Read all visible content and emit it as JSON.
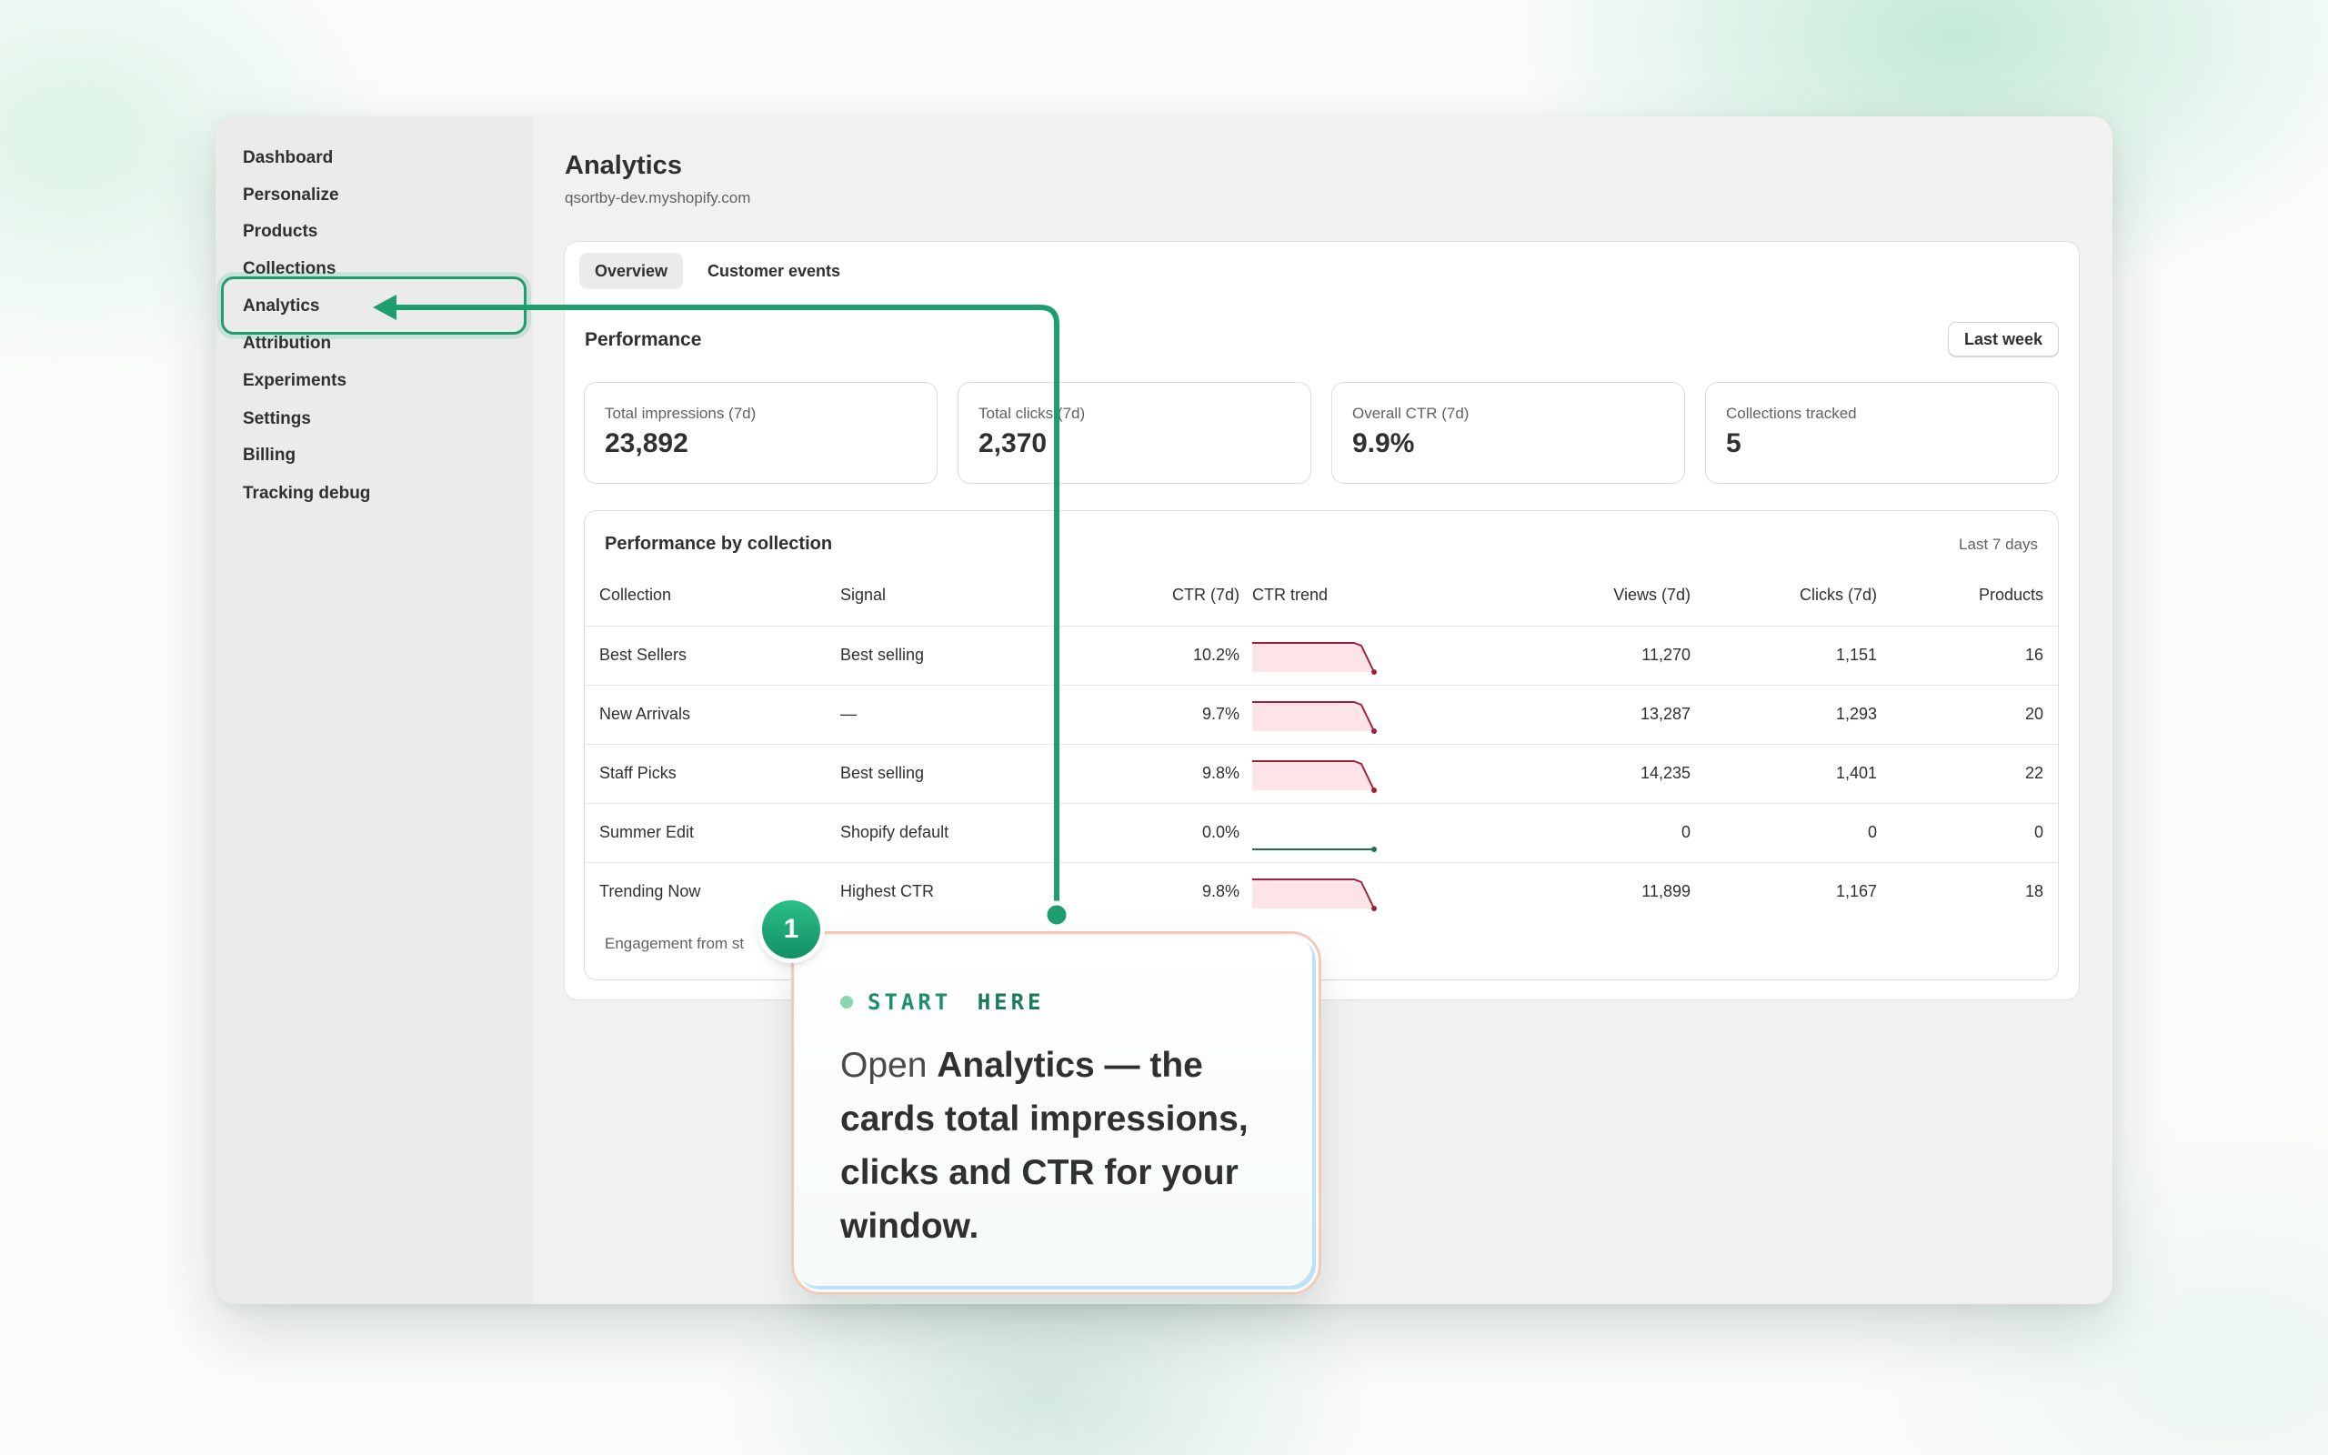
{
  "sidebar": {
    "items": [
      "Dashboard",
      "Personalize",
      "Products",
      "Collections",
      "Analytics",
      "Attribution",
      "Experiments",
      "Settings",
      "Billing",
      "Tracking debug"
    ]
  },
  "header": {
    "title": "Analytics",
    "subtitle": "qsortby-dev.myshopify.com"
  },
  "tabs": [
    "Overview",
    "Customer events"
  ],
  "performance": {
    "title": "Performance",
    "range_button": "Last week",
    "cards": [
      {
        "label": "Total impressions (7d)",
        "value": "23,892"
      },
      {
        "label": "Total clicks (7d)",
        "value": "2,370"
      },
      {
        "label": "Overall CTR (7d)",
        "value": "9.9%"
      },
      {
        "label": "Collections tracked",
        "value": "5"
      }
    ]
  },
  "table": {
    "title": "Performance by collection",
    "range": "Last 7 days",
    "columns": [
      "Collection",
      "Signal",
      "CTR (7d)",
      "CTR trend",
      "Views (7d)",
      "Clicks (7d)",
      "Products"
    ],
    "rows": [
      {
        "collection": "Best Sellers",
        "signal": "Best selling",
        "ctr": "10.2%",
        "views": "11,270",
        "clicks": "1,151",
        "products": "16",
        "trend": "drop"
      },
      {
        "collection": "New Arrivals",
        "signal": "—",
        "ctr": "9.7%",
        "views": "13,287",
        "clicks": "1,293",
        "products": "20",
        "trend": "drop"
      },
      {
        "collection": "Staff Picks",
        "signal": "Best selling",
        "ctr": "9.8%",
        "views": "14,235",
        "clicks": "1,401",
        "products": "22",
        "trend": "drop"
      },
      {
        "collection": "Summer Edit",
        "signal": "Shopify default",
        "ctr": "0.0%",
        "views": "0",
        "clicks": "0",
        "products": "0",
        "trend": "flat"
      },
      {
        "collection": "Trending Now",
        "signal": "Highest CTR",
        "ctr": "9.8%",
        "views": "11,899",
        "clicks": "1,167",
        "products": "18",
        "trend": "drop"
      }
    ],
    "footer": "Engagement from st"
  },
  "callout": {
    "step": "1",
    "tag_a": "START",
    "tag_b": "HERE",
    "text_open": "Open ",
    "text_bold": "Analytics — the cards total impressions, clicks and CTR for your window."
  },
  "colors": {
    "accent": "#1e9e6e",
    "trend_down": "#a0203c",
    "trend_flat": "#1f6f5a"
  }
}
